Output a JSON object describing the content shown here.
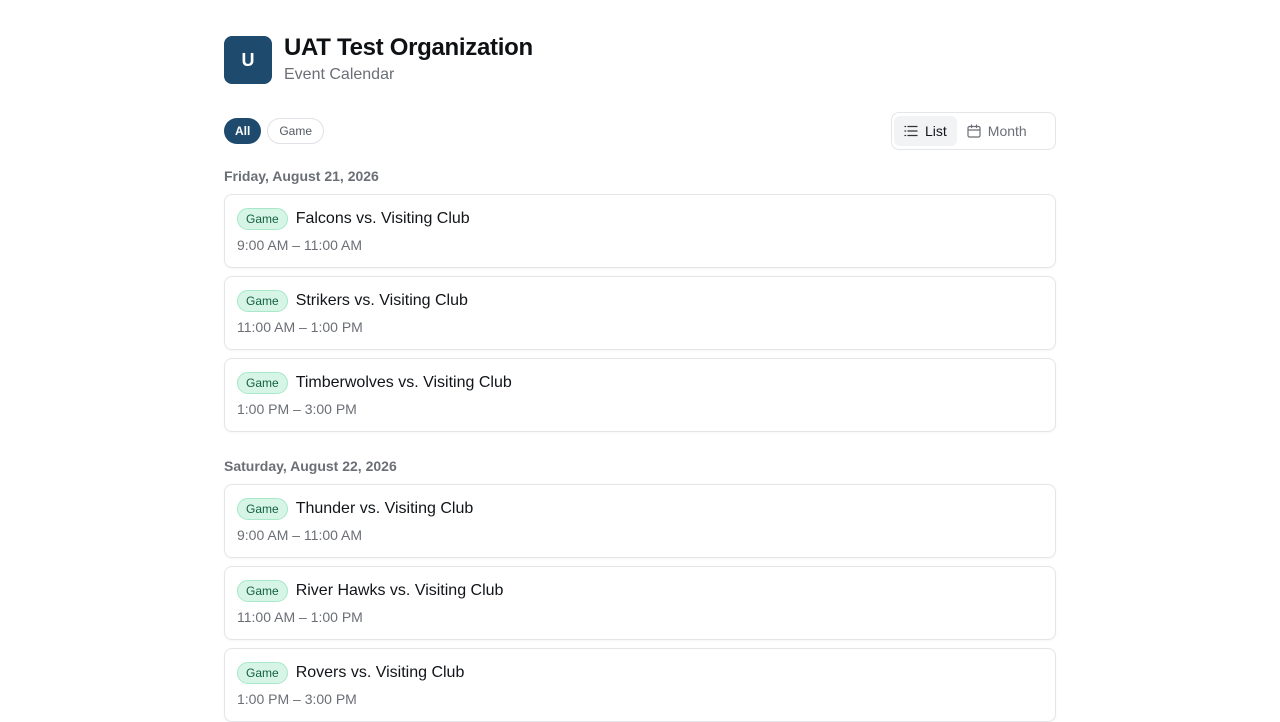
{
  "org": {
    "initial": "U",
    "name": "UAT Test Organization",
    "subtitle": "Event Calendar"
  },
  "filters": [
    {
      "label": "All",
      "active": true
    },
    {
      "label": "Game",
      "active": false
    }
  ],
  "views": [
    {
      "label": "List",
      "icon": "list-icon",
      "active": true
    },
    {
      "label": "Month",
      "icon": "calendar-icon",
      "active": false
    }
  ],
  "days": [
    {
      "date": "Friday, August 21, 2026",
      "events": [
        {
          "type": "Game",
          "title": "Falcons vs. Visiting Club",
          "time": "9:00 AM – 11:00 AM"
        },
        {
          "type": "Game",
          "title": "Strikers vs. Visiting Club",
          "time": "11:00 AM – 1:00 PM"
        },
        {
          "type": "Game",
          "title": "Timberwolves vs. Visiting Club",
          "time": "1:00 PM – 3:00 PM"
        }
      ]
    },
    {
      "date": "Saturday, August 22, 2026",
      "events": [
        {
          "type": "Game",
          "title": "Thunder vs. Visiting Club",
          "time": "9:00 AM – 11:00 AM"
        },
        {
          "type": "Game",
          "title": "River Hawks vs. Visiting Club",
          "time": "11:00 AM – 1:00 PM"
        },
        {
          "type": "Game",
          "title": "Rovers vs. Visiting Club",
          "time": "1:00 PM – 3:00 PM"
        }
      ]
    }
  ]
}
